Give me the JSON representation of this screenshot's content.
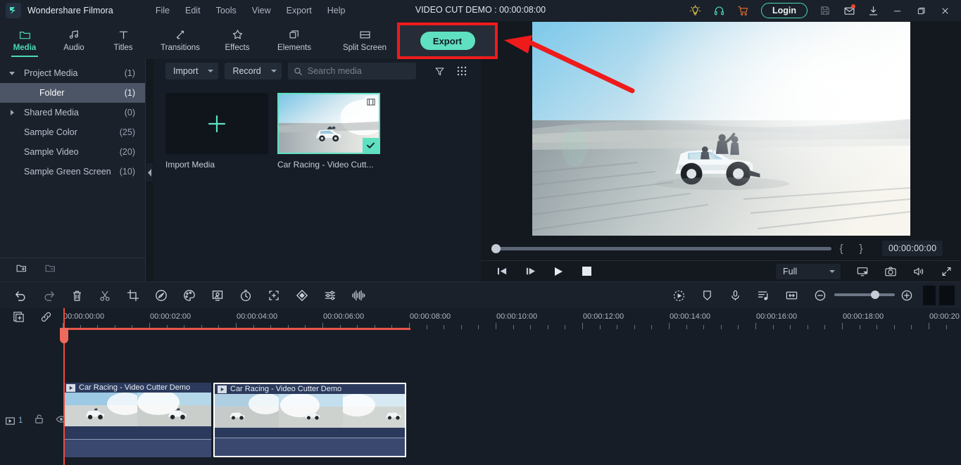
{
  "titlebar": {
    "app_name": "Wondershare Filmora",
    "menus": [
      "File",
      "Edit",
      "Tools",
      "View",
      "Export",
      "Help"
    ],
    "project_title": "VIDEO CUT DEMO : 00:00:08:00",
    "login_label": "Login",
    "icons": [
      {
        "name": "lightbulb-icon",
        "color": "#e8c44a"
      },
      {
        "name": "headset-icon",
        "color": "#4ad9b5"
      },
      {
        "name": "cart-icon",
        "color": "#e8712e"
      },
      {
        "name": "save-icon",
        "color": "#6e7886"
      },
      {
        "name": "mail-icon",
        "color": "#c8d0db",
        "badge": true
      },
      {
        "name": "download-icon",
        "color": "#c8d0db"
      },
      {
        "name": "minimize-icon",
        "color": "#c8d0db"
      },
      {
        "name": "maximize-icon",
        "color": "#c8d0db"
      },
      {
        "name": "close-icon",
        "color": "#c8d0db"
      }
    ]
  },
  "ribbon": {
    "tabs": [
      {
        "label": "Media",
        "icon": "folder-icon",
        "active": true
      },
      {
        "label": "Audio",
        "icon": "music-note-icon",
        "active": false
      },
      {
        "label": "Titles",
        "icon": "text-t-icon",
        "active": false
      },
      {
        "label": "Transitions",
        "icon": "transition-arrows-icon",
        "active": false
      },
      {
        "label": "Effects",
        "icon": "effects-star-icon",
        "active": false
      },
      {
        "label": "Elements",
        "icon": "elements-layers-icon",
        "active": false
      },
      {
        "label": "Split Screen",
        "icon": "split-screen-icon",
        "active": false
      }
    ],
    "export_label": "Export",
    "highlight_color": "#ef1b1b",
    "export_bg": "#5fe0c0"
  },
  "sidebar": {
    "items": [
      {
        "label": "Project Media",
        "count": "(1)",
        "twisty": "down",
        "indent": false,
        "selected": false
      },
      {
        "label": "Folder",
        "count": "(1)",
        "twisty": "none",
        "indent": true,
        "selected": true
      },
      {
        "label": "Shared Media",
        "count": "(0)",
        "twisty": "right",
        "indent": false,
        "selected": false
      },
      {
        "label": "Sample Color",
        "count": "(25)",
        "twisty": "none",
        "indent": false,
        "selected": false
      },
      {
        "label": "Sample Video",
        "count": "(20)",
        "twisty": "none",
        "indent": false,
        "selected": false
      },
      {
        "label": "Sample Green Screen",
        "count": "(10)",
        "twisty": "none",
        "indent": false,
        "selected": false
      }
    ],
    "footer_icons": [
      "add-folder-icon",
      "remove-folder-icon"
    ]
  },
  "media_panel": {
    "import_label": "Import",
    "record_label": "Record",
    "search_placeholder": "Search media",
    "search_value": "",
    "filter_icon": "filter-funnel-icon",
    "view_icon": "grid-view-icon",
    "items": [
      {
        "label": "Import Media",
        "type": "add"
      },
      {
        "label": "Car Racing - Video Cutt...",
        "type": "video",
        "selected": true
      }
    ]
  },
  "preview": {
    "timecode": "00:00:00:00",
    "mark_in": "{",
    "mark_out": "}",
    "quality_label": "Full",
    "transport_icons": [
      "prev-frame-icon",
      "next-frame-icon",
      "play-icon",
      "stop-icon"
    ],
    "right_icons": [
      "screen-cast-icon",
      "snapshot-camera-icon",
      "volume-icon",
      "fullscreen-icon"
    ],
    "scrub_position_pct": 0
  },
  "timeline_toolbar": {
    "left_icons": [
      "undo-icon",
      "redo-icon",
      "delete-icon",
      "split-scissors-icon",
      "crop-icon",
      "speed-icon",
      "color-palette-icon",
      "green-screen-icon",
      "duration-clock-icon",
      "pan-zoom-icon",
      "keyframe-diamond-icon",
      "adjust-sliders-icon",
      "audio-detach-icon"
    ],
    "right_icons": [
      "render-preview-icon",
      "marker-icon",
      "voiceover-mic-icon",
      "audio-mixer-icon",
      "fit-timeline-icon"
    ],
    "zoom_out_icon": "zoom-out-icon",
    "zoom_in_icon": "zoom-in-icon",
    "zoom_value_pct": 60
  },
  "timeline": {
    "head_icons": [
      "add-track-icon",
      "link-icon"
    ],
    "track_controls": {
      "track_number": "1",
      "lock_icon": "unlock-icon",
      "eye_icon": "eye-visible-icon"
    },
    "ruler_labels": [
      "00:00:00:00",
      "00:00:02:00",
      "00:00:04:00",
      "00:00:06:00",
      "00:00:08:00",
      "00:00:10:00",
      "00:00:12:00",
      "00:00:14:00",
      "00:00:16:00",
      "00:00:18:00",
      "00:00:20"
    ],
    "playhead_time": "00:00:00:00",
    "range_end_label": "00:00:08:00",
    "clips": [
      {
        "name": "Car Racing - Video Cutter Demo",
        "selected": false
      },
      {
        "name": "Car Racing - Video Cutter Demo",
        "selected": true
      }
    ]
  },
  "annotation": {
    "arrow_color": "#ef1b1b",
    "target": "export-button"
  }
}
